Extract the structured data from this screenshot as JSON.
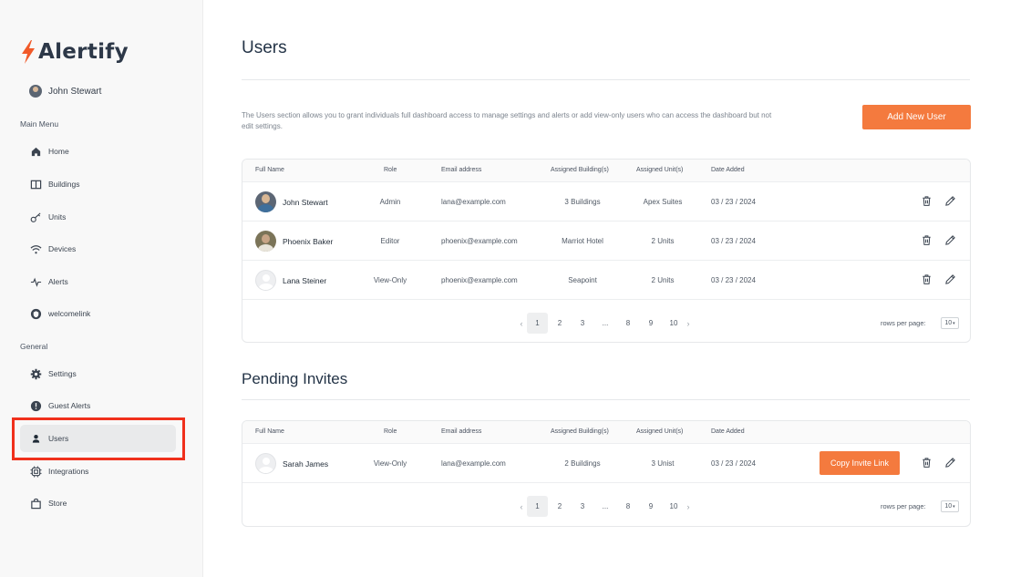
{
  "app": {
    "name": "Alertify"
  },
  "sidebar": {
    "user_name": "John Stewart",
    "main_menu_label": "Main Menu",
    "general_label": "General",
    "main_items": [
      {
        "label": "Home",
        "icon": "home-icon"
      },
      {
        "label": "Buildings",
        "icon": "book-icon"
      },
      {
        "label": "Units",
        "icon": "key-icon"
      },
      {
        "label": "Devices",
        "icon": "wifi-icon"
      },
      {
        "label": "Alerts",
        "icon": "pulse-icon"
      },
      {
        "label": "welcomelink",
        "icon": "shield-icon"
      }
    ],
    "general_items": [
      {
        "label": "Settings",
        "icon": "gear-icon"
      },
      {
        "label": "Guest Alerts",
        "icon": "alert-circle-icon"
      },
      {
        "label": "Users",
        "icon": "user-icon",
        "active": true
      },
      {
        "label": "Integrations",
        "icon": "integrations-icon"
      },
      {
        "label": "Store",
        "icon": "shopping-bag-icon"
      }
    ]
  },
  "main": {
    "title": "Users",
    "description": "The Users section allows you to grant individuals full dashboard access to manage settings and alerts or add view-only users who can access the dashboard but not edit settings.",
    "add_button": "Add New User",
    "columns": [
      "Full Name",
      "Role",
      "Email address",
      "Assigned Building(s)",
      "Assigned Unit(s)",
      "Date Added"
    ],
    "users": [
      {
        "name": "John Stewart",
        "role": "Admin",
        "email": "lana@example.com",
        "buildings": "3 Buildings",
        "units": "Apex Suites",
        "date": "03 / 23 / 2024"
      },
      {
        "name": "Phoenix Baker",
        "role": "Editor",
        "email": "phoenix@example.com",
        "buildings": "Marriot Hotel",
        "units": "2 Units",
        "date": "03 / 23 / 2024"
      },
      {
        "name": "Lana Steiner",
        "role": "View-Only",
        "email": "phoenix@example.com",
        "buildings": "Seapoint",
        "units": "2 Units",
        "date": "03 / 23 / 2024"
      }
    ],
    "pagination": {
      "prev": "‹",
      "next": "›",
      "pages": [
        "1",
        "2",
        "3",
        "...",
        "8",
        "9",
        "10"
      ],
      "current": "1",
      "rows_label": "rows per page:",
      "rows_value": "10"
    },
    "pending_title": "Pending Invites",
    "pending": [
      {
        "name": "Sarah James",
        "role": "View-Only",
        "email": "lana@example.com",
        "buildings": "2 Buildings",
        "units": "3 Unist",
        "date": "03 / 23 / 2024",
        "copy_label": "Copy Invite Link"
      }
    ]
  },
  "colors": {
    "accent": "#f47a3e",
    "highlight": "#f0301c",
    "active_nav": "#e9eaeb"
  }
}
